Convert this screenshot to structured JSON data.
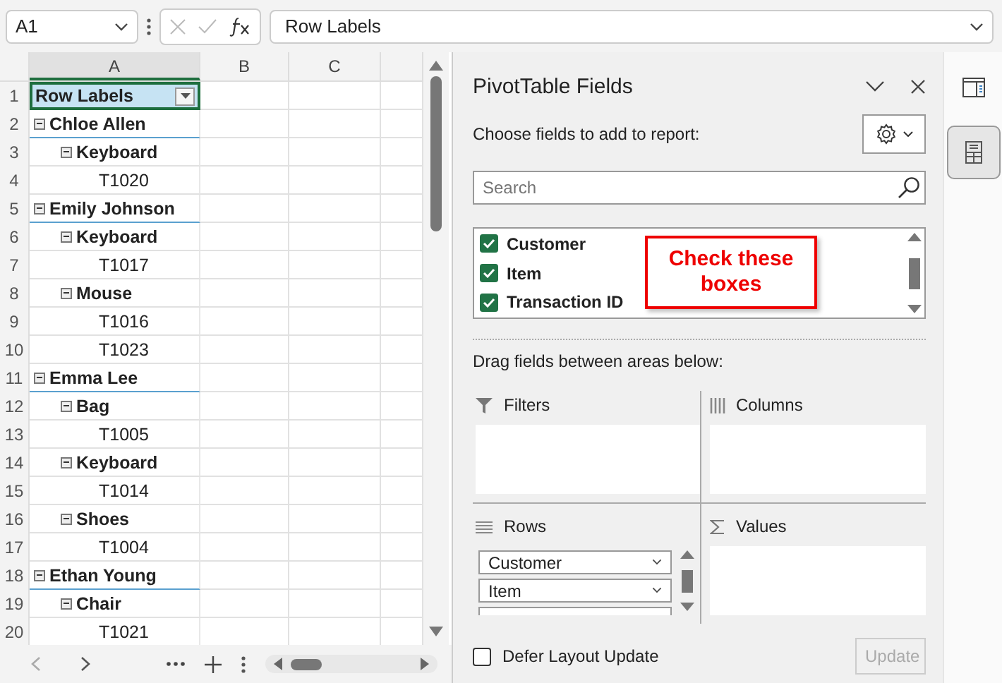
{
  "formula_bar": {
    "name_box": "A1",
    "formula": "Row Labels"
  },
  "sheet": {
    "columns": [
      "A",
      "B",
      "C"
    ],
    "row_numbers": [
      "1",
      "2",
      "3",
      "4",
      "5",
      "6",
      "7",
      "8",
      "9",
      "10",
      "11",
      "12",
      "13",
      "14",
      "15",
      "16",
      "17",
      "18",
      "19",
      "20"
    ],
    "header_cell": "Row Labels",
    "pivot_rows": [
      {
        "label": "Chloe Allen",
        "expanded": true,
        "children": [
          {
            "label": "Keyboard",
            "expanded": true,
            "children": [
              {
                "label": "T1020"
              }
            ]
          }
        ]
      },
      {
        "label": "Emily Johnson",
        "expanded": true,
        "children": [
          {
            "label": "Keyboard",
            "expanded": true,
            "children": [
              {
                "label": "T1017"
              }
            ]
          },
          {
            "label": "Mouse",
            "expanded": true,
            "children": [
              {
                "label": "T1016"
              },
              {
                "label": "T1023"
              }
            ]
          }
        ]
      },
      {
        "label": "Emma Lee",
        "expanded": true,
        "children": [
          {
            "label": "Bag",
            "expanded": true,
            "children": [
              {
                "label": "T1005"
              }
            ]
          },
          {
            "label": "Keyboard",
            "expanded": true,
            "children": [
              {
                "label": "T1014"
              }
            ]
          },
          {
            "label": "Shoes",
            "expanded": true,
            "children": [
              {
                "label": "T1004"
              }
            ]
          }
        ]
      },
      {
        "label": "Ethan Young",
        "expanded": true,
        "children": [
          {
            "label": "Chair",
            "expanded": true,
            "children": [
              {
                "label": "T1021"
              }
            ]
          }
        ]
      }
    ]
  },
  "pane": {
    "title": "PivotTable Fields",
    "subtitle": "Choose fields to add to report:",
    "search": {
      "placeholder": "Search"
    },
    "fields": [
      {
        "label": "Customer",
        "checked": true
      },
      {
        "label": "Item",
        "checked": true
      },
      {
        "label": "Transaction ID",
        "checked": true
      }
    ],
    "callout": "Check these boxes",
    "drag_hint": "Drag fields between areas below:",
    "areas": [
      {
        "kind": "filters",
        "label": "Filters"
      },
      {
        "kind": "columns",
        "label": "Columns"
      },
      {
        "kind": "rows",
        "label": "Rows",
        "items": [
          "Customer",
          "Item"
        ]
      },
      {
        "kind": "values",
        "label": "Values"
      }
    ],
    "defer": {
      "label": "Defer Layout Update",
      "checked": false
    },
    "update_button": {
      "label": "Update",
      "disabled": true
    }
  },
  "rail": [
    {
      "kind": "layout",
      "selected": false
    },
    {
      "kind": "fields",
      "selected": true
    }
  ]
}
